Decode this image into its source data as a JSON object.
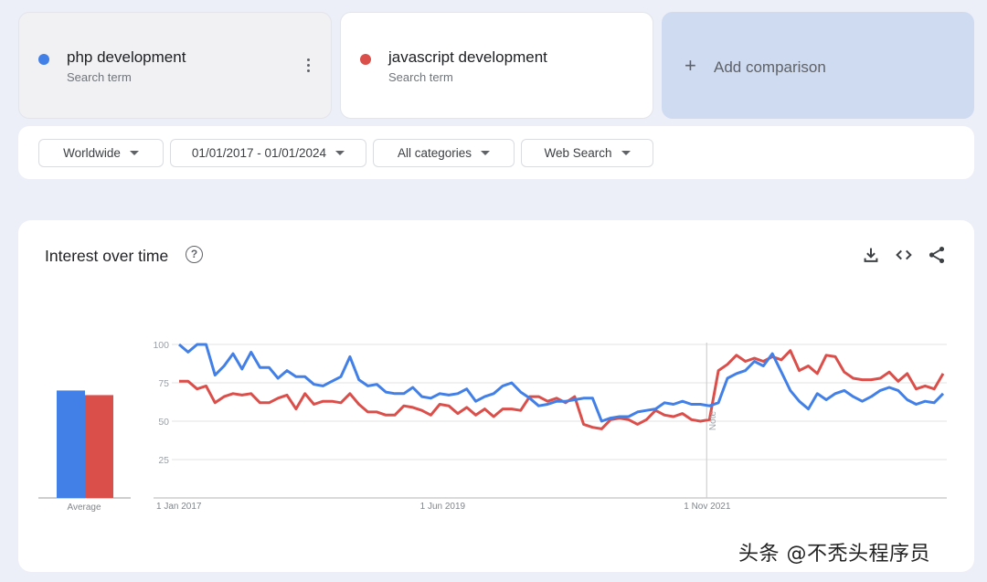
{
  "terms": [
    {
      "name": "php development",
      "sub": "Search term",
      "color": "#4280e8"
    },
    {
      "name": "javascript development",
      "sub": "Search term",
      "color": "#db4f4b"
    }
  ],
  "add_comparison": {
    "icon": "plus-icon",
    "label": "Add comparison"
  },
  "filters": {
    "region": "Worldwide",
    "date_range": "01/01/2017 - 01/01/2024",
    "category": "All categories",
    "search_type": "Web Search"
  },
  "panel": {
    "title": "Interest over time",
    "help_icon": "?",
    "actions": [
      "download-icon",
      "embed-code-icon",
      "share-icon"
    ]
  },
  "watermark": "头条 @不秃头程序员",
  "chart_data": {
    "type": "line",
    "title": "Interest over time",
    "xlabel": "",
    "ylabel": "",
    "ylim": [
      0,
      100
    ],
    "yticks": [
      25,
      50,
      75,
      100
    ],
    "grid": true,
    "x_tick_labels": [
      "1 Jan 2017",
      "1 Jun 2019",
      "1 Nov 2021"
    ],
    "x_tick_months": [
      0,
      29,
      58
    ],
    "x_range_months": [
      0,
      84
    ],
    "annotation": {
      "label": "Note",
      "month": 58
    },
    "average": {
      "label": "Average",
      "values": [
        {
          "name": "php development",
          "value": 70
        },
        {
          "name": "javascript development",
          "value": 67
        }
      ]
    },
    "series": [
      {
        "name": "php development",
        "color": "#4280e8",
        "values": [
          100,
          95,
          100,
          100,
          80,
          86,
          94,
          84,
          95,
          85,
          85,
          78,
          83,
          79,
          79,
          74,
          73,
          76,
          79,
          92,
          77,
          73,
          74,
          69,
          68,
          68,
          72,
          66,
          65,
          68,
          67,
          68,
          71,
          63,
          66,
          68,
          73,
          75,
          69,
          65,
          60,
          61,
          63,
          63,
          64,
          65,
          65,
          50,
          52,
          53,
          53,
          56,
          57,
          58,
          62,
          61,
          63,
          61,
          61,
          60,
          62,
          78,
          81,
          83,
          89,
          86,
          94,
          82,
          70,
          63,
          58,
          68,
          64,
          68,
          70,
          66,
          63,
          66,
          70,
          72,
          70,
          64,
          61,
          63,
          62,
          68
        ]
      },
      {
        "name": "javascript development",
        "color": "#db4f4b",
        "values": [
          76,
          76,
          71,
          73,
          62,
          66,
          68,
          67,
          68,
          62,
          62,
          65,
          67,
          58,
          68,
          61,
          63,
          63,
          62,
          68,
          61,
          56,
          56,
          54,
          54,
          60,
          59,
          57,
          54,
          61,
          60,
          55,
          59,
          54,
          58,
          53,
          58,
          58,
          57,
          66,
          66,
          63,
          65,
          62,
          66,
          48,
          46,
          45,
          51,
          52,
          51,
          48,
          51,
          57,
          54,
          53,
          55,
          51,
          50,
          51,
          83,
          87,
          93,
          89,
          91,
          89,
          92,
          90,
          96,
          83,
          86,
          81,
          93,
          92,
          82,
          78,
          77,
          77,
          78,
          82,
          76,
          81,
          71,
          73,
          71,
          81
        ]
      }
    ]
  }
}
